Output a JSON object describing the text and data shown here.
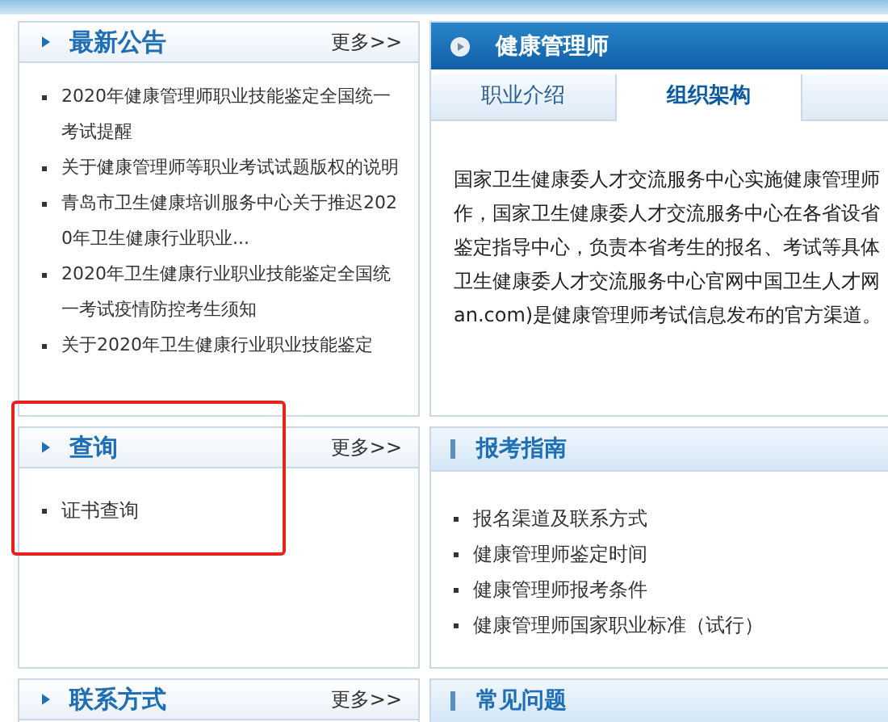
{
  "notices": {
    "title": "最新公告",
    "more": "更多>>",
    "items": [
      "2020年健康管理师职业技能鉴定全国统一考试提醒",
      "关于健康管理师等职业考试试题版权的说明",
      "青岛市卫生健康培训服务中心关于推迟2020年卫生健康行业职业...",
      "2020年卫生健康行业职业技能鉴定全国统一考试疫情防控考生须知",
      "关于2020年卫生健康行业职业技能鉴定"
    ]
  },
  "query": {
    "title": "查询",
    "more": "更多>>",
    "items": [
      "证书查询"
    ]
  },
  "contact": {
    "title": "联系方式",
    "more": "更多>>"
  },
  "profession": {
    "title": "健康管理师",
    "tabs": [
      {
        "label": "职业介绍",
        "selected": false
      },
      {
        "label": "组织架构",
        "selected": true
      }
    ],
    "lines": [
      "国家卫生健康委人才交流服务中心实施健康管理师",
      "作，国家卫生健康委人才交流服务中心在各省设省",
      "鉴定指导中心，负责本省考生的报名、考试等具体",
      "卫生健康委人才交流服务中心官网中国卫生人才网",
      "an.com)是健康管理师考试信息发布的官方渠道。"
    ]
  },
  "guide": {
    "title": "报考指南",
    "items": [
      "报名渠道及联系方式",
      "健康管理师鉴定时间",
      "健康管理师报考条件",
      "健康管理师国家职业标准（试行）"
    ]
  },
  "faq": {
    "title": "常见问题"
  }
}
